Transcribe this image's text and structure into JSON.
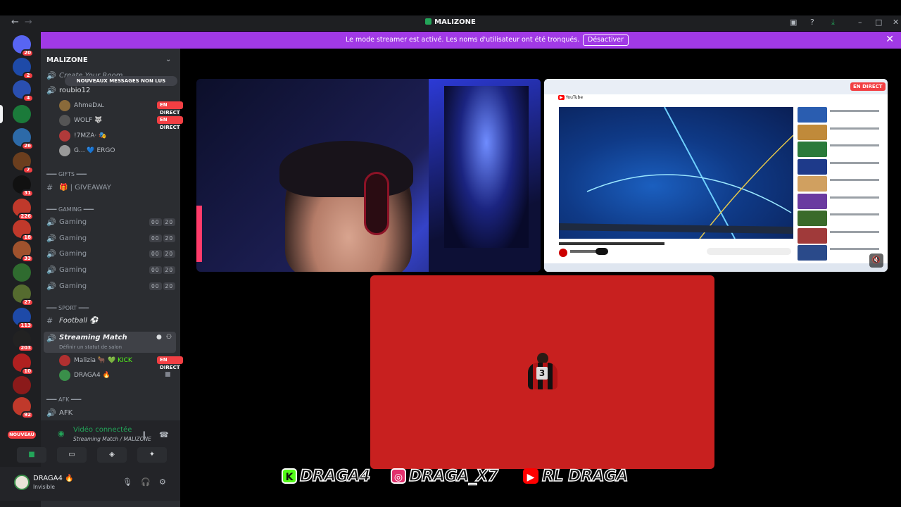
{
  "window": {
    "title": "MALIZONE"
  },
  "banner": {
    "message": "Le mode streamer est activé. Les noms d'utilisateur ont été tronqués.",
    "button": "Désactiver"
  },
  "servers": [
    {
      "badge": "20",
      "color": "#5865f2"
    },
    {
      "badge": "2",
      "color": "#1e4aa8"
    },
    {
      "badge": "4",
      "color": "#2a4fb0"
    },
    {
      "badge": "",
      "color": "#1b7a3a"
    },
    {
      "badge": "26",
      "color": "#2d6aa8"
    },
    {
      "badge": "7",
      "color": "#6b3e1e"
    },
    {
      "badge": "31",
      "color": "#111111"
    },
    {
      "badge": "226",
      "color": "#c0392b"
    },
    {
      "badge": "18",
      "color": "#c0392b"
    },
    {
      "badge": "33",
      "color": "#a0522d"
    },
    {
      "badge": "",
      "color": "#2f6b2f"
    },
    {
      "badge": "27",
      "color": "#556b2f"
    },
    {
      "badge": "113",
      "color": "#1e4aa8"
    },
    {
      "badge": "203",
      "color": "#222222"
    },
    {
      "badge": "10",
      "color": "#b02020"
    },
    {
      "badge": "",
      "color": "#8b1a1a"
    },
    {
      "badge": "92",
      "color": "#c0392b"
    }
  ],
  "new_label": "NOUVEAU",
  "sidebar": {
    "guild_name": "MALIZONE",
    "unread_pill": "NOUVEAUX MESSAGES NON LUS",
    "create_room": "Create Your Room",
    "voice_channel_1": "roubio12",
    "users_1": [
      {
        "name": "AhmeDᴀʟ",
        "live": "EN DIRECT",
        "color": "#8a6a3a"
      },
      {
        "name": "WOLF 🐺",
        "live": "EN DIRECT",
        "color": "#555555"
      },
      {
        "name": "!7MZA· 🎭",
        "live": "",
        "color": "#b03a3a"
      },
      {
        "name": "G... 💙 ERGO",
        "live": "",
        "color": "#999999"
      }
    ],
    "cat_gifts": "━━━ GIFTS ━━━",
    "giveaway": "🎁 | GIVEAWAY",
    "cat_gaming": "━━━ GAMING ━━━",
    "gaming_channels": [
      {
        "name": "Gaming",
        "a": "00",
        "b": "20"
      },
      {
        "name": "Gaming",
        "a": "00",
        "b": "20"
      },
      {
        "name": "Gaming",
        "a": "00",
        "b": "20"
      },
      {
        "name": "Gaming",
        "a": "00",
        "b": "20"
      },
      {
        "name": "Gaming",
        "a": "00",
        "b": "20"
      }
    ],
    "cat_sport": "━━━ SPORT ━━━",
    "football": "Football ⚽",
    "streaming": "Streaming Match",
    "streaming_status": "Définir un statut de salon",
    "users_2": [
      {
        "name": "Malizia 🐂",
        "extra": "💚 KICK",
        "live": "EN DIRECT",
        "color": "#b03030"
      },
      {
        "name": "DRAGA4 🔥",
        "extra": "",
        "live": "",
        "color": "#3a8f4a"
      }
    ],
    "cat_afk": "━━━ AFK ━━━",
    "afk": "AFK"
  },
  "voice": {
    "status": "Vidéo connectée",
    "channel": "Streaming Match / MALIZONE"
  },
  "user": {
    "name": "DRAGA4 🔥",
    "status": "Invisible"
  },
  "stage": {
    "live_tag": "EN DIRECT"
  },
  "overlay": {
    "kick": "DRAGA4",
    "instagram": "DRAGA_X7",
    "youtube": "RL DRAGA"
  }
}
